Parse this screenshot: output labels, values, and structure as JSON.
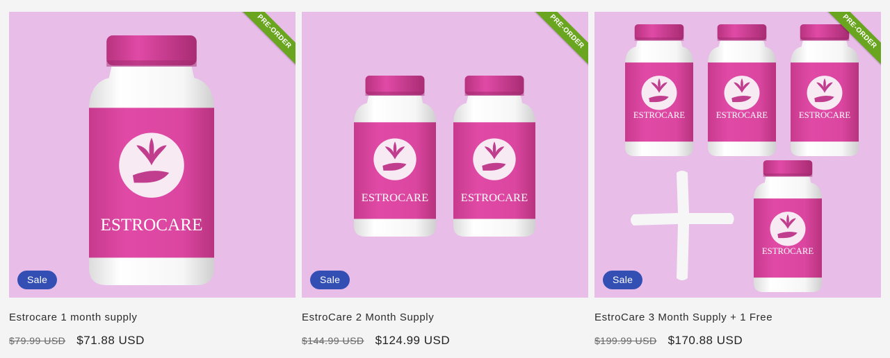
{
  "products": [
    {
      "title": "Estrocare 1 month supply",
      "compare_price": "$79.99 USD",
      "sale_price": "$71.88 USD",
      "badge": "Sale",
      "ribbon": "PRE-ORDER",
      "bottle_label": "ESTROCARE"
    },
    {
      "title": "EstroCare 2 Month Supply",
      "compare_price": "$144.99 USD",
      "sale_price": "$124.99 USD",
      "badge": "Sale",
      "ribbon": "PRE-ORDER",
      "bottle_label": "ESTROCARE"
    },
    {
      "title": "EstroCare 3 Month Supply + 1 Free",
      "compare_price": "$199.99 USD",
      "sale_price": "$170.88 USD",
      "badge": "Sale",
      "ribbon": "PRE-ORDER",
      "bottle_label": "ESTROCARE"
    }
  ],
  "colors": {
    "image_background": "#e8bde8",
    "bottle_label": "#d9449e",
    "bottle_cap": "#d14396",
    "sale_badge": "#334fb4",
    "ribbon": "#6aa51f"
  }
}
